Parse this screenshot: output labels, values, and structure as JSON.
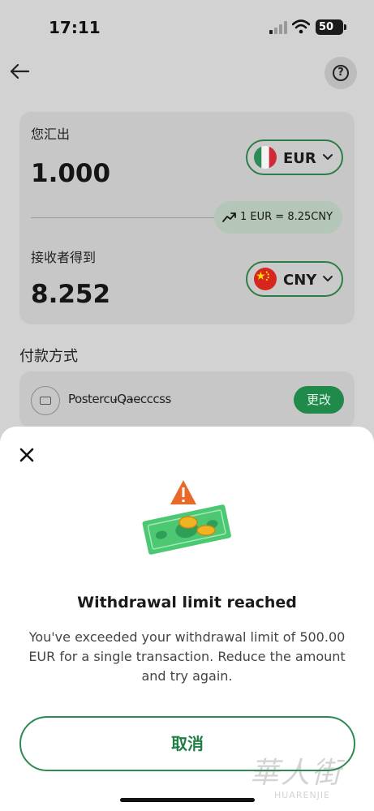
{
  "status_bar": {
    "time": "17:11",
    "battery": "50"
  },
  "header": {
    "back_icon": "arrow-left-icon",
    "help_icon": "question-circle-icon",
    "help_glyph": "?"
  },
  "transfer": {
    "send_label": "您汇出",
    "send_amount": "1.000",
    "send_currency": "EUR",
    "send_flag": "italy-flag-icon",
    "rate": "1 EUR =  8.25CNY",
    "recv_label": "接收者得到",
    "recv_amount": "8.252",
    "recv_currency": "CNY",
    "recv_flag": "china-flag-icon"
  },
  "payment": {
    "title": "付款方式",
    "method_name": "Postercu̵Q̵a̵e̵cccss",
    "change_label": "更改"
  },
  "modal": {
    "title": "Withdrawal limit reached",
    "body": "You've exceeded your withdrawal limit of 500.00 EUR for a single transaction. Reduce the amount and try again.",
    "cancel_label": "取消"
  },
  "watermark": {
    "cn": "華人街",
    "en": "HUARENJIE"
  },
  "colors": {
    "accent_green": "#1f8a4a",
    "warning_orange": "#e8692a"
  }
}
